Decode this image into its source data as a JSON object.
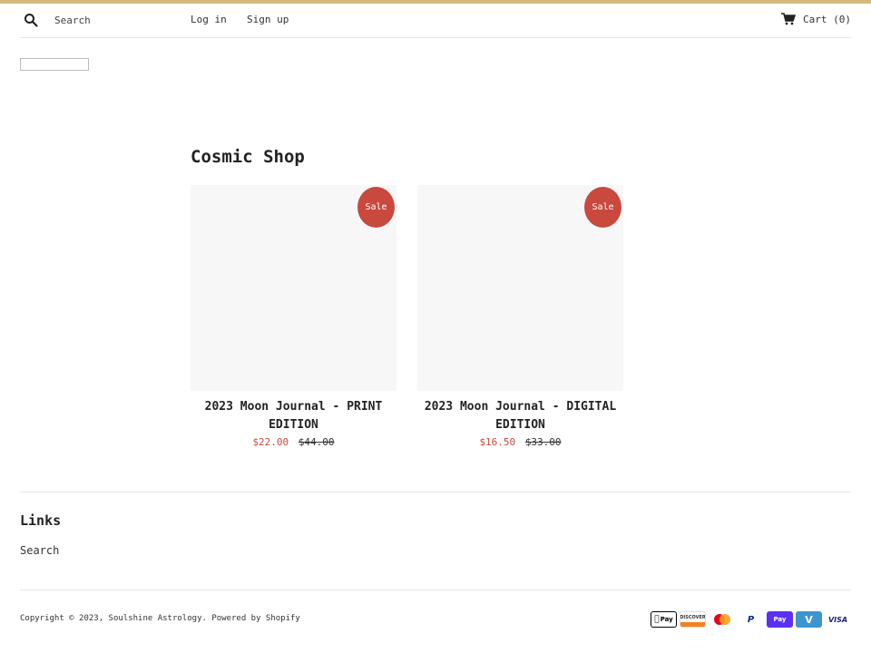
{
  "header": {
    "search_placeholder": "Search",
    "login_label": "Log in",
    "signup_label": "Sign up",
    "cart_label": "Cart (0)"
  },
  "collection": {
    "title": "Cosmic Shop",
    "products": [
      {
        "badge": "Sale",
        "title": "2023 Moon Journal - PRINT EDITION",
        "price": "$22.00",
        "compare_price": "$44.00"
      },
      {
        "badge": "Sale",
        "title": "2023 Moon Journal - DIGITAL EDITION",
        "price": "$16.50",
        "compare_price": "$33.00"
      }
    ]
  },
  "footer": {
    "links_heading": "Links",
    "links": [
      "Search"
    ],
    "copyright": "Copyright © 2023, Soulshine Astrology. Powered by Shopify",
    "payment_icons": [
      "apple-pay",
      "discover",
      "master",
      "paypal",
      "shop-pay",
      "venmo",
      "visa"
    ],
    "payment_labels": {
      "apple": "Pay",
      "discover": "DISCOVER",
      "paypal": "P",
      "shop": "Pay",
      "venmo": "V",
      "visa": "VISA"
    }
  },
  "colors": {
    "accent_bar": "#d4b97f",
    "sale": "#c9493f"
  }
}
